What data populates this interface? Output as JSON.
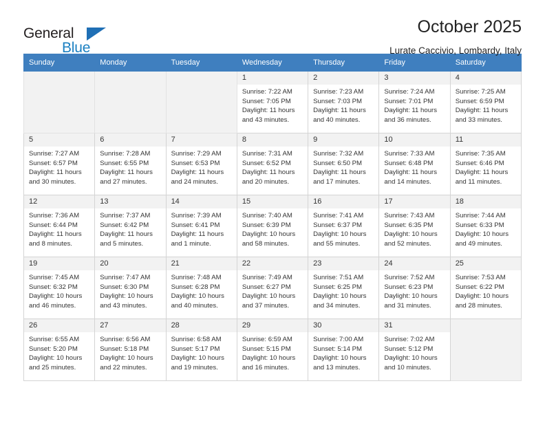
{
  "brand": {
    "name_top": "General",
    "name_bottom": "Blue",
    "accent_color": "#1f6fb5"
  },
  "header": {
    "title": "October 2025",
    "subtitle": "Lurate Caccivio, Lombardy, Italy"
  },
  "calendar": {
    "header_bg": "#3f7fbf",
    "weekdays": [
      "Sunday",
      "Monday",
      "Tuesday",
      "Wednesday",
      "Thursday",
      "Friday",
      "Saturday"
    ],
    "leading_blanks": 3,
    "days": [
      {
        "num": "1",
        "sunrise": "Sunrise: 7:22 AM",
        "sunset": "Sunset: 7:05 PM",
        "daylight1": "Daylight: 11 hours",
        "daylight2": "and 43 minutes."
      },
      {
        "num": "2",
        "sunrise": "Sunrise: 7:23 AM",
        "sunset": "Sunset: 7:03 PM",
        "daylight1": "Daylight: 11 hours",
        "daylight2": "and 40 minutes."
      },
      {
        "num": "3",
        "sunrise": "Sunrise: 7:24 AM",
        "sunset": "Sunset: 7:01 PM",
        "daylight1": "Daylight: 11 hours",
        "daylight2": "and 36 minutes."
      },
      {
        "num": "4",
        "sunrise": "Sunrise: 7:25 AM",
        "sunset": "Sunset: 6:59 PM",
        "daylight1": "Daylight: 11 hours",
        "daylight2": "and 33 minutes."
      },
      {
        "num": "5",
        "sunrise": "Sunrise: 7:27 AM",
        "sunset": "Sunset: 6:57 PM",
        "daylight1": "Daylight: 11 hours",
        "daylight2": "and 30 minutes."
      },
      {
        "num": "6",
        "sunrise": "Sunrise: 7:28 AM",
        "sunset": "Sunset: 6:55 PM",
        "daylight1": "Daylight: 11 hours",
        "daylight2": "and 27 minutes."
      },
      {
        "num": "7",
        "sunrise": "Sunrise: 7:29 AM",
        "sunset": "Sunset: 6:53 PM",
        "daylight1": "Daylight: 11 hours",
        "daylight2": "and 24 minutes."
      },
      {
        "num": "8",
        "sunrise": "Sunrise: 7:31 AM",
        "sunset": "Sunset: 6:52 PM",
        "daylight1": "Daylight: 11 hours",
        "daylight2": "and 20 minutes."
      },
      {
        "num": "9",
        "sunrise": "Sunrise: 7:32 AM",
        "sunset": "Sunset: 6:50 PM",
        "daylight1": "Daylight: 11 hours",
        "daylight2": "and 17 minutes."
      },
      {
        "num": "10",
        "sunrise": "Sunrise: 7:33 AM",
        "sunset": "Sunset: 6:48 PM",
        "daylight1": "Daylight: 11 hours",
        "daylight2": "and 14 minutes."
      },
      {
        "num": "11",
        "sunrise": "Sunrise: 7:35 AM",
        "sunset": "Sunset: 6:46 PM",
        "daylight1": "Daylight: 11 hours",
        "daylight2": "and 11 minutes."
      },
      {
        "num": "12",
        "sunrise": "Sunrise: 7:36 AM",
        "sunset": "Sunset: 6:44 PM",
        "daylight1": "Daylight: 11 hours",
        "daylight2": "and 8 minutes."
      },
      {
        "num": "13",
        "sunrise": "Sunrise: 7:37 AM",
        "sunset": "Sunset: 6:42 PM",
        "daylight1": "Daylight: 11 hours",
        "daylight2": "and 5 minutes."
      },
      {
        "num": "14",
        "sunrise": "Sunrise: 7:39 AM",
        "sunset": "Sunset: 6:41 PM",
        "daylight1": "Daylight: 11 hours",
        "daylight2": "and 1 minute."
      },
      {
        "num": "15",
        "sunrise": "Sunrise: 7:40 AM",
        "sunset": "Sunset: 6:39 PM",
        "daylight1": "Daylight: 10 hours",
        "daylight2": "and 58 minutes."
      },
      {
        "num": "16",
        "sunrise": "Sunrise: 7:41 AM",
        "sunset": "Sunset: 6:37 PM",
        "daylight1": "Daylight: 10 hours",
        "daylight2": "and 55 minutes."
      },
      {
        "num": "17",
        "sunrise": "Sunrise: 7:43 AM",
        "sunset": "Sunset: 6:35 PM",
        "daylight1": "Daylight: 10 hours",
        "daylight2": "and 52 minutes."
      },
      {
        "num": "18",
        "sunrise": "Sunrise: 7:44 AM",
        "sunset": "Sunset: 6:33 PM",
        "daylight1": "Daylight: 10 hours",
        "daylight2": "and 49 minutes."
      },
      {
        "num": "19",
        "sunrise": "Sunrise: 7:45 AM",
        "sunset": "Sunset: 6:32 PM",
        "daylight1": "Daylight: 10 hours",
        "daylight2": "and 46 minutes."
      },
      {
        "num": "20",
        "sunrise": "Sunrise: 7:47 AM",
        "sunset": "Sunset: 6:30 PM",
        "daylight1": "Daylight: 10 hours",
        "daylight2": "and 43 minutes."
      },
      {
        "num": "21",
        "sunrise": "Sunrise: 7:48 AM",
        "sunset": "Sunset: 6:28 PM",
        "daylight1": "Daylight: 10 hours",
        "daylight2": "and 40 minutes."
      },
      {
        "num": "22",
        "sunrise": "Sunrise: 7:49 AM",
        "sunset": "Sunset: 6:27 PM",
        "daylight1": "Daylight: 10 hours",
        "daylight2": "and 37 minutes."
      },
      {
        "num": "23",
        "sunrise": "Sunrise: 7:51 AM",
        "sunset": "Sunset: 6:25 PM",
        "daylight1": "Daylight: 10 hours",
        "daylight2": "and 34 minutes."
      },
      {
        "num": "24",
        "sunrise": "Sunrise: 7:52 AM",
        "sunset": "Sunset: 6:23 PM",
        "daylight1": "Daylight: 10 hours",
        "daylight2": "and 31 minutes."
      },
      {
        "num": "25",
        "sunrise": "Sunrise: 7:53 AM",
        "sunset": "Sunset: 6:22 PM",
        "daylight1": "Daylight: 10 hours",
        "daylight2": "and 28 minutes."
      },
      {
        "num": "26",
        "sunrise": "Sunrise: 6:55 AM",
        "sunset": "Sunset: 5:20 PM",
        "daylight1": "Daylight: 10 hours",
        "daylight2": "and 25 minutes."
      },
      {
        "num": "27",
        "sunrise": "Sunrise: 6:56 AM",
        "sunset": "Sunset: 5:18 PM",
        "daylight1": "Daylight: 10 hours",
        "daylight2": "and 22 minutes."
      },
      {
        "num": "28",
        "sunrise": "Sunrise: 6:58 AM",
        "sunset": "Sunset: 5:17 PM",
        "daylight1": "Daylight: 10 hours",
        "daylight2": "and 19 minutes."
      },
      {
        "num": "29",
        "sunrise": "Sunrise: 6:59 AM",
        "sunset": "Sunset: 5:15 PM",
        "daylight1": "Daylight: 10 hours",
        "daylight2": "and 16 minutes."
      },
      {
        "num": "30",
        "sunrise": "Sunrise: 7:00 AM",
        "sunset": "Sunset: 5:14 PM",
        "daylight1": "Daylight: 10 hours",
        "daylight2": "and 13 minutes."
      },
      {
        "num": "31",
        "sunrise": "Sunrise: 7:02 AM",
        "sunset": "Sunset: 5:12 PM",
        "daylight1": "Daylight: 10 hours",
        "daylight2": "and 10 minutes."
      }
    ]
  }
}
